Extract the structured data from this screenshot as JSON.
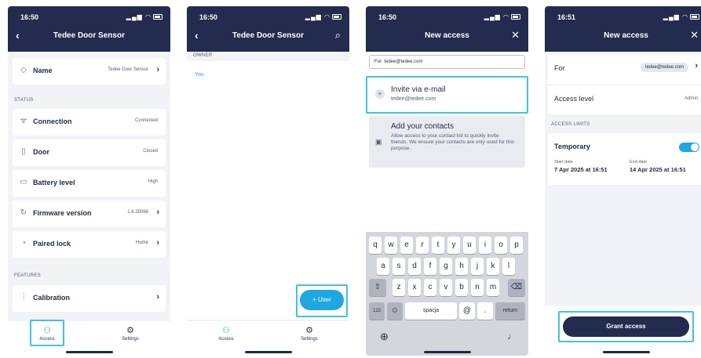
{
  "screen1": {
    "time": "16:50",
    "title": "Tedee Door Sensor",
    "name_row": {
      "label": "Name",
      "value": "Tedee Door Sensor"
    },
    "status_section": "STATUS",
    "status_rows": [
      {
        "label": "Connection",
        "value": "Connected",
        "icon": "wifi-icon"
      },
      {
        "label": "Door",
        "value": "Closed",
        "icon": "door-icon"
      },
      {
        "label": "Battery level",
        "value": "High",
        "icon": "battery-icon"
      },
      {
        "label": "Firmware version",
        "value": "1.6.35068",
        "icon": "refresh-icon"
      },
      {
        "label": "Paired lock",
        "value": "Home",
        "icon": "lock-icon"
      }
    ],
    "features_section": "FEATURES",
    "calibration_label": "Calibration",
    "tabs": [
      {
        "label": "Access"
      },
      {
        "label": "Settings"
      }
    ]
  },
  "screen2": {
    "time": "16:50",
    "title": "Tedee Door Sensor",
    "owner_section": "OWNER",
    "owner_value": "You",
    "fab_label": "+ User",
    "tabs": [
      {
        "label": "Access"
      },
      {
        "label": "Settings"
      }
    ]
  },
  "screen3": {
    "time": "16:50",
    "title": "New access",
    "for_input": "For: tedee@tedee.com",
    "invite_title": "Invite via e-mail",
    "invite_email": "tedee@tedee.com",
    "contacts_title": "Add your contacts",
    "contacts_desc": "Allow access to your contact list to quickly invite friends. We ensure your contacts are only used for this purpose.",
    "keyboard": {
      "row1": [
        "q",
        "w",
        "e",
        "r",
        "t",
        "y",
        "u",
        "i",
        "o",
        "p"
      ],
      "row2": [
        "a",
        "s",
        "d",
        "f",
        "g",
        "h",
        "j",
        "k",
        "l"
      ],
      "row3": [
        "z",
        "x",
        "c",
        "v",
        "b",
        "n",
        "m"
      ],
      "num_key": "123",
      "space_key": "spacja",
      "at_key": "@",
      "dot_key": ".",
      "return_key": "return"
    }
  },
  "screen4": {
    "time": "16:51",
    "title": "New access",
    "for_label": "For",
    "for_value": "tedee@tedee.com",
    "access_level_label": "Access level",
    "access_level_value": "Admin",
    "limits_section": "ACCESS LIMITS",
    "temporary_label": "Temporary",
    "start_label": "Start date",
    "start_value": "7 Apr 2025 at 16:51",
    "end_label": "End date",
    "end_value": "14 Apr 2025 at 16:51",
    "grant_label": "Grant access"
  },
  "colors": {
    "header": "#232b4e",
    "accent": "#1ea7e0",
    "highlight": "#43c1e4"
  }
}
